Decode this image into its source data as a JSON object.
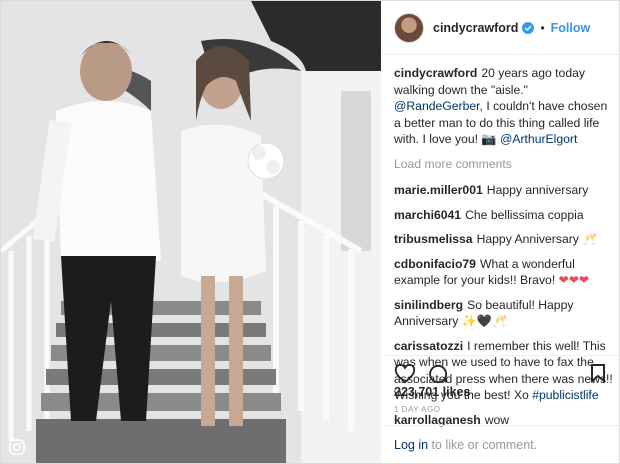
{
  "header": {
    "username": "cindycrawford",
    "dot": "•",
    "follow_label": "Follow"
  },
  "caption": {
    "username": "cindycrawford",
    "text_part1": "20 years ago today walking down the \"aisle.\"",
    "mention1": "@RandeGerber",
    "text_part2": ", I couldn't have chosen a better man to do this thing called life with. I love you!",
    "camera_emoji": "📷",
    "mention2": "@ArthurElgort"
  },
  "load_more_label": "Load more comments",
  "comments": [
    {
      "username": "marie.miller001",
      "text": "Happy anniversary"
    },
    {
      "username": "marchi6041",
      "text": "Che bellissima coppia"
    },
    {
      "username": "tribusmelissa",
      "text": "Happy Anniversary 🥂"
    },
    {
      "username": "cdbonifacio79",
      "text": "What a wonderful example for your kids!! Bravo!",
      "hearts": "❤❤❤"
    },
    {
      "username": "sinilindberg",
      "text": "So beautiful! Happy Anniversary ✨🖤🥂"
    },
    {
      "username": "carissatozzi",
      "text": "I remember this well! This was when we used to have to fax the associated press when there was news!! Wishing you the best! Xo",
      "hashtag": "#publicistlife"
    },
    {
      "username": "karrollaganesh",
      "text": "wow"
    }
  ],
  "likes_text": "223,701 likes",
  "timestamp": "1 DAY AGO",
  "login": {
    "link_label": "Log in",
    "rest": "to like or comment."
  },
  "colors": {
    "link_blue": "#3897f0",
    "mention_navy": "#003569",
    "muted": "#999999",
    "heart_red": "#ed4956"
  },
  "icons": [
    "verified-badge-icon",
    "heart-icon",
    "comment-icon",
    "bookmark-icon",
    "camera-icon",
    "instagram-icon"
  ]
}
